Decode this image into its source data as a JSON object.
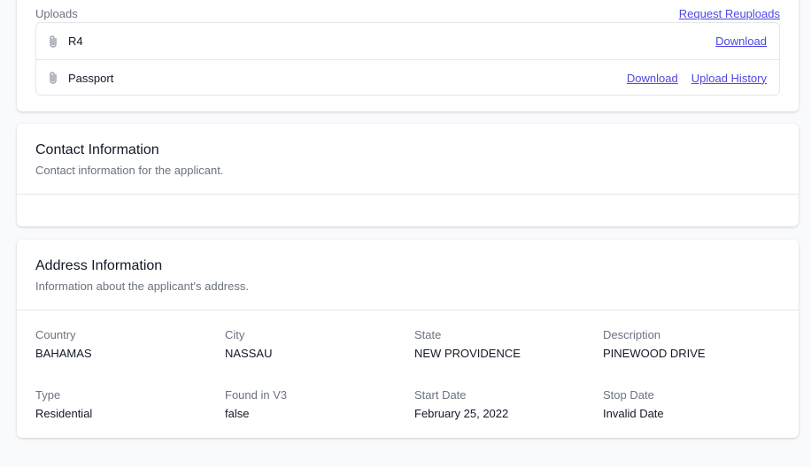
{
  "uploads": {
    "label": "Uploads",
    "request_link": "Request Reuploads",
    "files": [
      {
        "name": "R4",
        "download": "Download"
      },
      {
        "name": "Passport",
        "download": "Download",
        "history": "Upload History"
      }
    ]
  },
  "contact": {
    "title": "Contact Information",
    "subtitle": "Contact information for the applicant."
  },
  "address": {
    "title": "Address Information",
    "subtitle": "Information about the applicant's address.",
    "fields": [
      {
        "label": "Country",
        "value": "BAHAMAS"
      },
      {
        "label": "City",
        "value": "NASSAU"
      },
      {
        "label": "State",
        "value": "NEW PROVIDENCE"
      },
      {
        "label": "Description",
        "value": "PINEWOOD DRIVE"
      },
      {
        "label": "Type",
        "value": "Residential"
      },
      {
        "label": "Found in V3",
        "value": "false"
      },
      {
        "label": "Start Date",
        "value": "February 25, 2022"
      },
      {
        "label": "Stop Date",
        "value": "Invalid Date"
      }
    ]
  },
  "colors": {
    "link": "#4f46e5",
    "muted": "#6b7280",
    "border": "#e5e7eb"
  },
  "icons": {
    "attachment": "paperclip-icon"
  }
}
